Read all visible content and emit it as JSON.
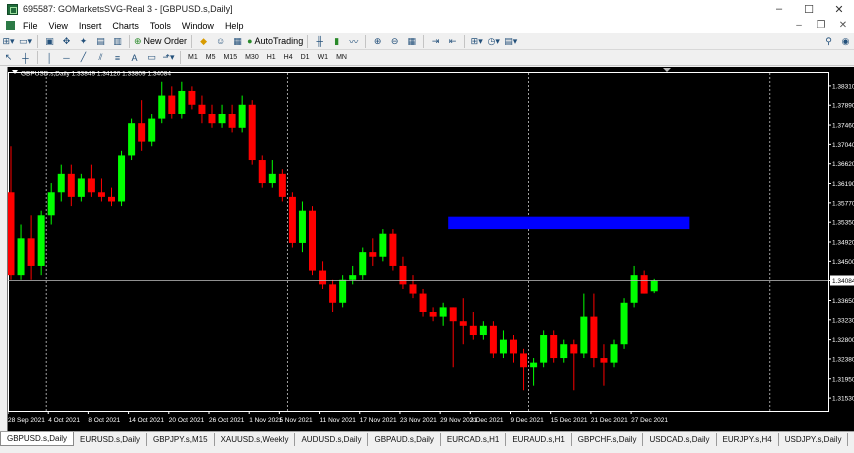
{
  "window": {
    "title": "695587: GOMarketsSVG-Real 3 - [GBPUSD.s,Daily]"
  },
  "menu": [
    "File",
    "View",
    "Insert",
    "Charts",
    "Tools",
    "Window",
    "Help"
  ],
  "toolbar": {
    "new_order": "New Order",
    "autotrading": "AutoTrading"
  },
  "timeframes": [
    "M1",
    "M5",
    "M15",
    "M30",
    "H1",
    "H4",
    "D1",
    "W1",
    "MN"
  ],
  "chart_data": {
    "type": "candlestick",
    "title": "GBPUSD.s,Daily  1.33849 1.34120 1.33809 1.34084",
    "current_price": 1.34084,
    "ylim": [
      1.3125,
      1.3859
    ],
    "y_ticks": [
      "1.38310",
      "1.37890",
      "1.37460",
      "1.37040",
      "1.36620",
      "1.36190",
      "1.35770",
      "1.35350",
      "1.34920",
      "1.34500",
      "1.34084",
      "1.33650",
      "1.33230",
      "1.32800",
      "1.32380",
      "1.31950",
      "1.31530"
    ],
    "y_tick_values": [
      1.3831,
      1.3789,
      1.3746,
      1.3704,
      1.3662,
      1.3619,
      1.3577,
      1.3535,
      1.3492,
      1.345,
      1.34084,
      1.3365,
      1.3323,
      1.328,
      1.3238,
      1.3195,
      1.3153
    ],
    "x_labels": [
      "28 Sep 2021",
      "4 Oct 2021",
      "8 Oct 2021",
      "14 Oct 2021",
      "20 Oct 2021",
      "26 Oct 2021",
      "1 Nov 2021",
      "5 Nov 2021",
      "11 Nov 2021",
      "17 Nov 2021",
      "23 Nov 2021",
      "29 Nov 2021",
      "3 Dec 2021",
      "9 Dec 2021",
      "15 Dec 2021",
      "21 Dec 2021",
      "27 Dec 2021"
    ],
    "x_label_index": [
      0,
      4,
      8,
      12,
      16,
      20,
      24,
      27,
      31,
      35,
      39,
      43,
      46,
      50,
      54,
      58,
      62
    ],
    "candles": [
      [
        1.36,
        1.37,
        1.341,
        1.342
      ],
      [
        1.342,
        1.353,
        1.341,
        1.35
      ],
      [
        1.35,
        1.355,
        1.341,
        1.344
      ],
      [
        1.344,
        1.356,
        1.342,
        1.355
      ],
      [
        1.355,
        1.362,
        1.353,
        1.36
      ],
      [
        1.36,
        1.366,
        1.358,
        1.364
      ],
      [
        1.364,
        1.366,
        1.357,
        1.359
      ],
      [
        1.359,
        1.364,
        1.358,
        1.363
      ],
      [
        1.363,
        1.366,
        1.359,
        1.36
      ],
      [
        1.36,
        1.363,
        1.358,
        1.359
      ],
      [
        1.359,
        1.361,
        1.357,
        1.358
      ],
      [
        1.358,
        1.369,
        1.357,
        1.368
      ],
      [
        1.368,
        1.376,
        1.367,
        1.375
      ],
      [
        1.375,
        1.38,
        1.369,
        1.371
      ],
      [
        1.371,
        1.377,
        1.37,
        1.376
      ],
      [
        1.376,
        1.384,
        1.375,
        1.381
      ],
      [
        1.381,
        1.383,
        1.376,
        1.377
      ],
      [
        1.377,
        1.384,
        1.376,
        1.382
      ],
      [
        1.382,
        1.383,
        1.378,
        1.379
      ],
      [
        1.379,
        1.381,
        1.375,
        1.377
      ],
      [
        1.377,
        1.379,
        1.374,
        1.375
      ],
      [
        1.375,
        1.379,
        1.374,
        1.377
      ],
      [
        1.377,
        1.379,
        1.373,
        1.374
      ],
      [
        1.374,
        1.381,
        1.373,
        1.379
      ],
      [
        1.379,
        1.38,
        1.366,
        1.367
      ],
      [
        1.367,
        1.368,
        1.361,
        1.362
      ],
      [
        1.362,
        1.367,
        1.361,
        1.364
      ],
      [
        1.364,
        1.365,
        1.358,
        1.359
      ],
      [
        1.359,
        1.36,
        1.348,
        1.349
      ],
      [
        1.349,
        1.358,
        1.347,
        1.356
      ],
      [
        1.356,
        1.357,
        1.342,
        1.343
      ],
      [
        1.343,
        1.345,
        1.339,
        1.34
      ],
      [
        1.34,
        1.341,
        1.334,
        1.336
      ],
      [
        1.336,
        1.342,
        1.335,
        1.341
      ],
      [
        1.341,
        1.344,
        1.34,
        1.342
      ],
      [
        1.342,
        1.348,
        1.341,
        1.347
      ],
      [
        1.347,
        1.35,
        1.344,
        1.346
      ],
      [
        1.346,
        1.352,
        1.345,
        1.351
      ],
      [
        1.351,
        1.352,
        1.343,
        1.344
      ],
      [
        1.344,
        1.346,
        1.339,
        1.34
      ],
      [
        1.34,
        1.342,
        1.337,
        1.338
      ],
      [
        1.338,
        1.339,
        1.333,
        1.334
      ],
      [
        1.334,
        1.335,
        1.332,
        1.333
      ],
      [
        1.333,
        1.336,
        1.331,
        1.335
      ],
      [
        1.335,
        1.335,
        1.322,
        1.332
      ],
      [
        1.332,
        1.337,
        1.327,
        1.331
      ],
      [
        1.331,
        1.334,
        1.328,
        1.329
      ],
      [
        1.329,
        1.332,
        1.328,
        1.331
      ],
      [
        1.331,
        1.332,
        1.324,
        1.325
      ],
      [
        1.325,
        1.33,
        1.324,
        1.328
      ],
      [
        1.328,
        1.329,
        1.323,
        1.325
      ],
      [
        1.325,
        1.326,
        1.317,
        1.322
      ],
      [
        1.322,
        1.324,
        1.318,
        1.323
      ],
      [
        1.323,
        1.33,
        1.322,
        1.329
      ],
      [
        1.329,
        1.33,
        1.323,
        1.324
      ],
      [
        1.324,
        1.328,
        1.323,
        1.327
      ],
      [
        1.327,
        1.328,
        1.317,
        1.325
      ],
      [
        1.325,
        1.338,
        1.324,
        1.333
      ],
      [
        1.333,
        1.338,
        1.322,
        1.324
      ],
      [
        1.324,
        1.327,
        1.318,
        1.323
      ],
      [
        1.323,
        1.328,
        1.322,
        1.327
      ],
      [
        1.327,
        1.337,
        1.326,
        1.336
      ],
      [
        1.336,
        1.344,
        1.335,
        1.342
      ],
      [
        1.342,
        1.343,
        1.338,
        1.338
      ],
      [
        1.3385,
        1.3412,
        1.3381,
        1.3408
      ]
    ],
    "zone": {
      "from_index": 44,
      "to_index": 67,
      "top": 1.3547,
      "bottom": 1.352,
      "color": "#0000ff"
    },
    "colors": {
      "bull": "#00ff00",
      "bear": "#ff0000",
      "background": "#000000",
      "foreground": "#ffffff",
      "grid": "#c8c8c8"
    },
    "grid": true,
    "vertical_lines_index": [
      3.5,
      27.5,
      51.5,
      75.5
    ]
  },
  "tabs": [
    "GBPUSD.s,Daily",
    "EURUSD.s,Daily",
    "GBPJPY.s,M15",
    "XAUUSD.s,Weekly",
    "AUDUSD.s,Daily",
    "GBPAUD.s,Daily",
    "EURCAD.s,H1",
    "EURAUD.s,H1",
    "GBPCHF.s,Daily",
    "USDCAD.s,Daily",
    "EURJPY.s,H4",
    "USDJPY.s,Daily"
  ],
  "active_tab": 0
}
